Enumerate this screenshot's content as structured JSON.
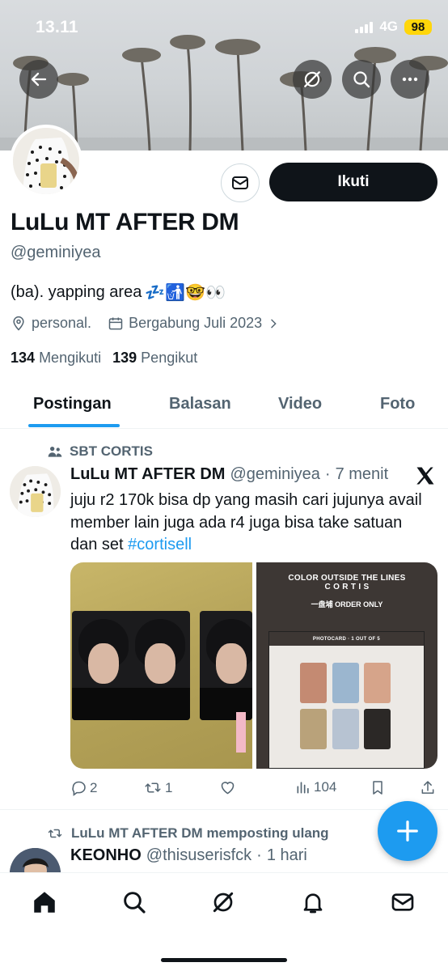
{
  "status_bar": {
    "time": "13.11",
    "network": "4G",
    "battery": "98"
  },
  "header": {
    "back_icon": "arrow-left-icon",
    "grok_icon": "grok-icon",
    "search_icon": "search-icon",
    "more_icon": "more-horizontal-icon"
  },
  "profile": {
    "display_name": "LuLu MT AFTER DM",
    "handle": "@geminiyea",
    "bio_text": "(ba). yapping area",
    "bio_emojis": "💤🚮🤓👀",
    "location": "personal.",
    "joined": "Bergabung Juli 2023",
    "following_count": "134",
    "following_label": "Mengikuti",
    "followers_count": "139",
    "followers_label": "Pengikut",
    "follow_button": "Ikuti"
  },
  "tabs": [
    {
      "label": "Postingan"
    },
    {
      "label": "Balasan"
    },
    {
      "label": "Video"
    },
    {
      "label": "Foto"
    }
  ],
  "post1": {
    "community": "SBT CORTIS",
    "author_name": "LuLu MT AFTER DM",
    "author_handle": "@geminiyea",
    "separator": "·",
    "time": "7 menit",
    "text": "juju r2 170k bisa dp yang masih cari jujunya avail member lain juga ada r4 juga bisa take satuan dan set",
    "hashtag": "#cortisell",
    "media_right": {
      "title_line1": "COLOR OUTSIDE THE LINES",
      "title_line2": "C O R T I S",
      "order_text": "一盘埔 ORDER ONLY",
      "card_header": "PHOTOCARD · 1 OUT OF 5"
    },
    "replies": "2",
    "reposts": "1",
    "likes": "",
    "views": "104"
  },
  "post2": {
    "repost_label": "LuLu MT AFTER DM memposting ulang",
    "author_name": "KEONHO",
    "author_handle": "@thisuserisfck",
    "separator": "·",
    "time": "1 hari"
  },
  "colors": {
    "accent": "#1d9bf0",
    "text": "#0f1419",
    "muted": "#536471"
  }
}
